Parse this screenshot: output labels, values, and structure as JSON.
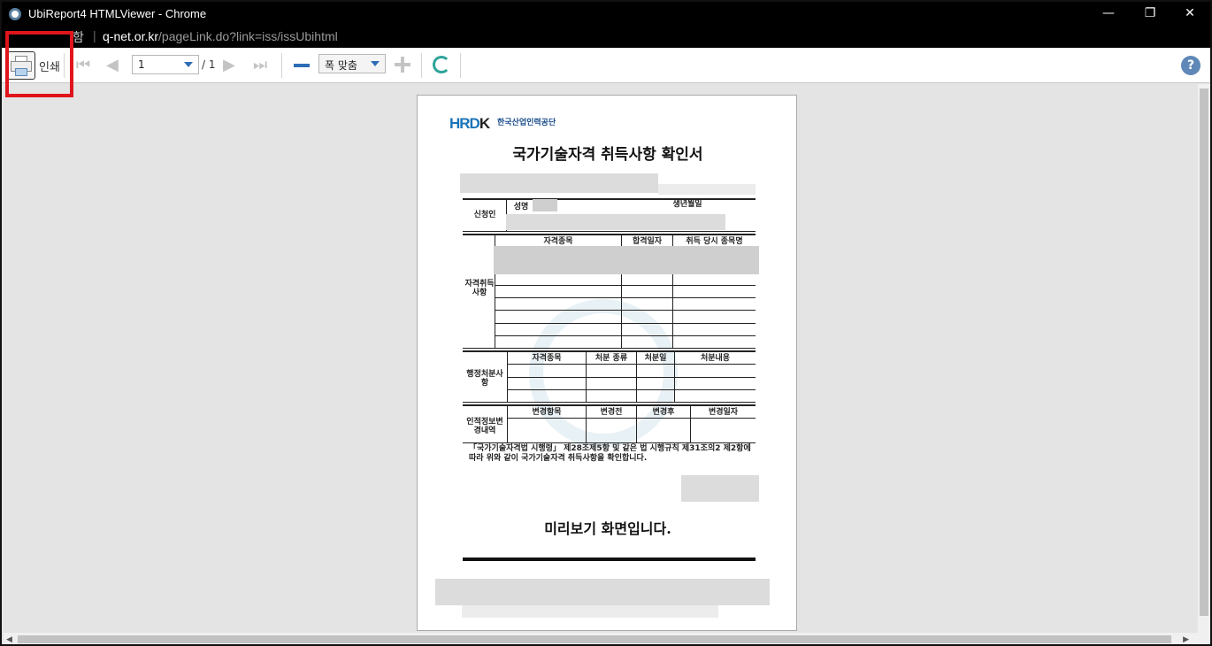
{
  "window": {
    "title": "UbiReport4 HTMLViewer - Chrome",
    "controls": {
      "minimize": "—",
      "restore": "❐",
      "close": "✕"
    }
  },
  "urlbar": {
    "security_text": "함",
    "domain": "q-net.or.kr",
    "path": "/pageLink.do?link=iss/issUbihtml"
  },
  "toolbar": {
    "print_label": "인쇄",
    "page_current": "1",
    "page_total": "/ 1",
    "zoom_option": "폭 맞춤",
    "help_label": "?"
  },
  "document": {
    "logo_text": "HRD",
    "logo_k": "K",
    "logo_org": "한국산업인력공단",
    "title": "국가기술자격 취득사항 확인서",
    "applicant_label": "신청인",
    "name_label": "성명",
    "birth_label": "생년월일",
    "qual_section_label": "자격취득사항",
    "qual_headers": [
      "자격종목",
      "합격일자",
      "취득 당시 종목명"
    ],
    "admin_section_label": "행정처분사항",
    "admin_headers": [
      "자격종목",
      "처분 종류",
      "처분일",
      "처분내용"
    ],
    "personal_section_label": "인적정보변경내역",
    "personal_headers": [
      "변경항목",
      "변경전",
      "변경후",
      "변경일자"
    ],
    "statement": "「국가기술자격법 시행령」 제28조제5항 및 같은 법 시행규칙 제31조의2 제2항에 따라 위와 같이 국가기술자격 취득사항을 확인합니다.",
    "preview_message": "미리보기 화면입니다."
  }
}
